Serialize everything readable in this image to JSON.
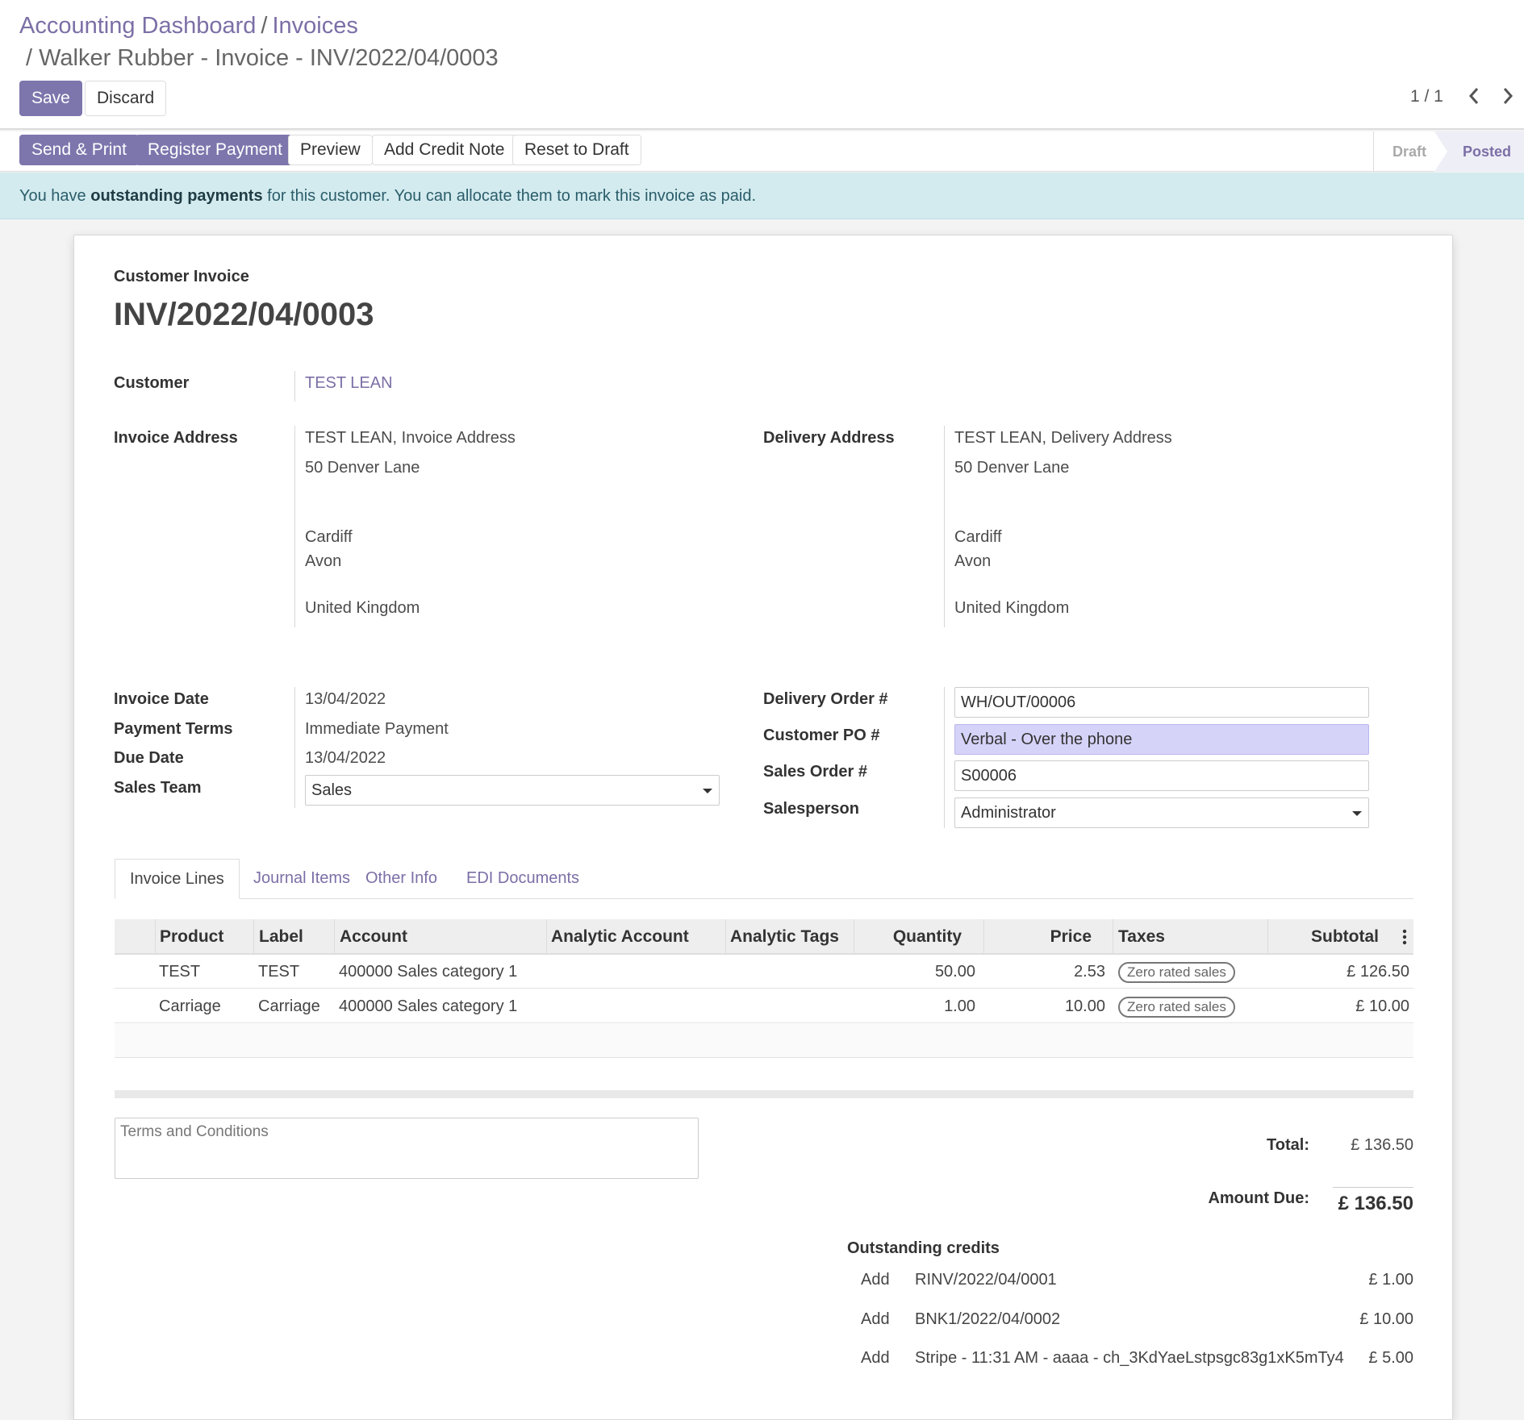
{
  "breadcrumb": {
    "parent1": "Accounting Dashboard",
    "parent2": "Invoices",
    "current": "/ Walker Rubber - Invoice - INV/2022/04/0003"
  },
  "toolbar": {
    "save_label": "Save",
    "discard_label": "Discard"
  },
  "pager": {
    "text": "1 / 1"
  },
  "actions": {
    "send_print": "Send & Print",
    "register_payment": "Register Payment",
    "preview": "Preview",
    "add_credit_note": "Add Credit Note",
    "reset_to_draft": "Reset to Draft"
  },
  "status": {
    "draft": "Draft",
    "posted": "Posted",
    "active": "Posted"
  },
  "alert": {
    "before": "You have ",
    "bold": "outstanding payments",
    "after": " for this customer. You can allocate them to mark this invoice as paid."
  },
  "invoice": {
    "type_label": "Customer Invoice",
    "number": "INV/2022/04/0003",
    "customer_label": "Customer",
    "customer": "TEST LEAN",
    "invoice_address_label": "Invoice Address",
    "invoice_address": {
      "line1": "TEST LEAN, Invoice Address",
      "line2": "50 Denver Lane",
      "city": "Cardiff",
      "state": "Avon",
      "country": "United Kingdom"
    },
    "delivery_address_label": "Delivery Address",
    "delivery_address": {
      "line1": "TEST LEAN, Delivery Address",
      "line2": "50 Denver Lane",
      "city": "Cardiff",
      "state": "Avon",
      "country": "United Kingdom"
    },
    "invoice_date_label": "Invoice Date",
    "invoice_date": "13/04/2022",
    "payment_terms_label": "Payment Terms",
    "payment_terms": "Immediate Payment",
    "due_date_label": "Due Date",
    "due_date": "13/04/2022",
    "sales_team_label": "Sales Team",
    "sales_team": "Sales",
    "delivery_order_label": "Delivery Order #",
    "delivery_order": "WH/OUT/00006",
    "customer_po_label": "Customer PO #",
    "customer_po": "Verbal - Over the phone",
    "sales_order_label": "Sales Order #",
    "sales_order": "S00006",
    "salesperson_label": "Salesperson",
    "salesperson": "Administrator"
  },
  "tabs": [
    "Invoice Lines",
    "Journal Items",
    "Other Info",
    "EDI Documents"
  ],
  "lines": {
    "headers": [
      "Product",
      "Label",
      "Account",
      "Analytic Account",
      "Analytic Tags",
      "Quantity",
      "Price",
      "Taxes",
      "Subtotal"
    ],
    "rows": [
      {
        "product": "TEST",
        "label": "TEST",
        "account": "400000 Sales category 1",
        "quantity": "50.00",
        "price": "2.53",
        "tax": "Zero rated sales",
        "subtotal": "£ 126.50"
      },
      {
        "product": "Carriage",
        "label": "Carriage",
        "account": "400000 Sales category 1",
        "quantity": "1.00",
        "price": "10.00",
        "tax": "Zero rated sales",
        "subtotal": "£ 10.00"
      }
    ]
  },
  "terms": {
    "placeholder": "Terms and Conditions"
  },
  "totals": {
    "total_label": "Total:",
    "total": "£ 136.50",
    "amount_due_label": "Amount Due:",
    "amount_due": "£ 136.50"
  },
  "credits": {
    "title": "Outstanding credits",
    "add_label": "Add",
    "items": [
      {
        "ref": "RINV/2022/04/0001",
        "amount": "£ 1.00"
      },
      {
        "ref": "BNK1/2022/04/0002",
        "amount": "£ 10.00"
      },
      {
        "ref": "Stripe - 11:31 AM - aaaa - ch_3KdYaeLstpsgc83g1xK5mTy4",
        "amount": "£ 5.00"
      }
    ]
  },
  "colors": {
    "primary": "#7c76ad",
    "link": "#7c6fa6",
    "alert_bg": "#d3ebef",
    "highlight": "#d5d3f8"
  }
}
